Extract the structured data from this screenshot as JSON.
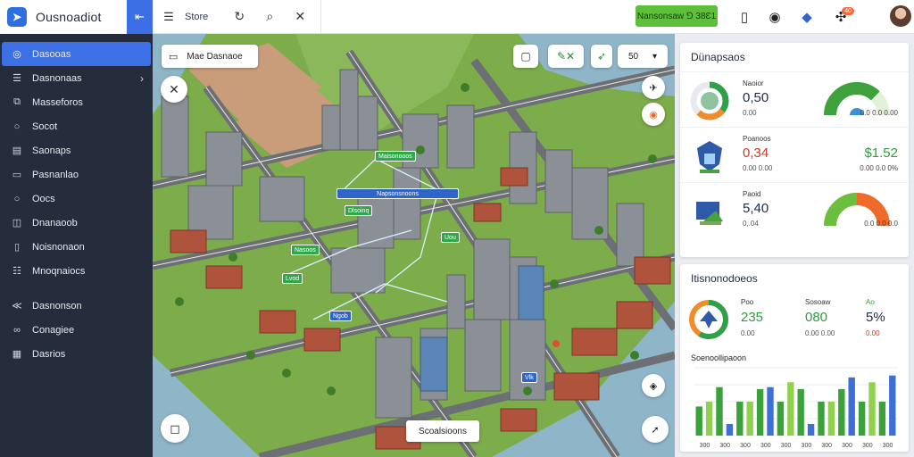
{
  "app": {
    "name": "Ousnoadiot",
    "toggle_icon": "collapse-icon"
  },
  "sidebar": {
    "items": [
      {
        "label": "Dasooas",
        "icon": "compass-icon",
        "active": true
      },
      {
        "label": "Dasnonaas",
        "icon": "list-icon",
        "chevron": true
      },
      {
        "label": "Masseforos",
        "icon": "layers-icon"
      },
      {
        "label": "Socot",
        "icon": "circle-icon"
      },
      {
        "label": "Saonaps",
        "icon": "grid-icon"
      },
      {
        "label": "Pasnanlao",
        "icon": "folder-icon"
      },
      {
        "label": "Oocs",
        "icon": "circle-icon"
      },
      {
        "label": "Dnanaoob",
        "icon": "box-icon"
      },
      {
        "label": "Noisnonaon",
        "icon": "doc-icon"
      },
      {
        "label": "Mnoqnaiocs",
        "icon": "table-icon"
      }
    ],
    "items_bottom": [
      {
        "label": "Dasnonson",
        "icon": "share-icon"
      },
      {
        "label": "Conagiee",
        "icon": "link-icon"
      },
      {
        "label": "Dasrios",
        "icon": "calendar-icon"
      }
    ]
  },
  "topbar": {
    "label": "Store",
    "green_button": "Nansonsaw ⅁ 38Ɛ1",
    "badge": "40"
  },
  "map": {
    "search_label": "Mae Dasnaoe",
    "zoom_value": "50",
    "bottom_label": "Scoalsioons",
    "pins": [
      "Maisonooos",
      "Napsonsnoons",
      "Dlsoinq",
      "Nasoos",
      "Lvod",
      "Ngob",
      "Vlk",
      "Uou"
    ]
  },
  "panel1": {
    "title": "Dünapsaos",
    "rows": [
      {
        "label": "Naoior",
        "value": "0,50",
        "sub": "0.00",
        "gauge_foot": "0.0  0.0  0.00"
      },
      {
        "label": "Poanoos",
        "value": "0,34",
        "sub": "0.00  0.00",
        "right_value": "$1.52",
        "right_foot": "0.00  0.0 0%"
      },
      {
        "label": "Paoid",
        "value": "5,40",
        "sub": "0,.04",
        "gauge_foot": "0.0  0.0  0.0"
      }
    ]
  },
  "panel2": {
    "title": "Itisnonodoeos",
    "stats": [
      {
        "label": "Poo",
        "value": "235",
        "sub": "0.00"
      },
      {
        "label": "Sosoaw",
        "value": "080",
        "sub": "0.00  0.00"
      },
      {
        "label": "Ao",
        "value": "5%",
        "sub": "0.00"
      }
    ],
    "chart_title": "Soenoollipaoon"
  },
  "chart_data": {
    "type": "bar",
    "title": "Soenoollipaoon",
    "categories": [
      "300",
      "300",
      "300",
      "300",
      "300",
      "300",
      "300",
      "300",
      "300",
      "300"
    ],
    "series": [
      {
        "values": [
          30,
          35,
          50,
          12,
          35,
          35,
          48,
          50,
          35,
          55,
          48,
          12,
          35,
          35,
          48,
          60,
          35,
          55,
          35,
          62
        ]
      }
    ],
    "ylim": [
      0,
      70
    ],
    "grid": true,
    "colors": {
      "green": "#3ba23b",
      "light_green": "#8fd14f",
      "blue": "#3d6fd6"
    }
  }
}
